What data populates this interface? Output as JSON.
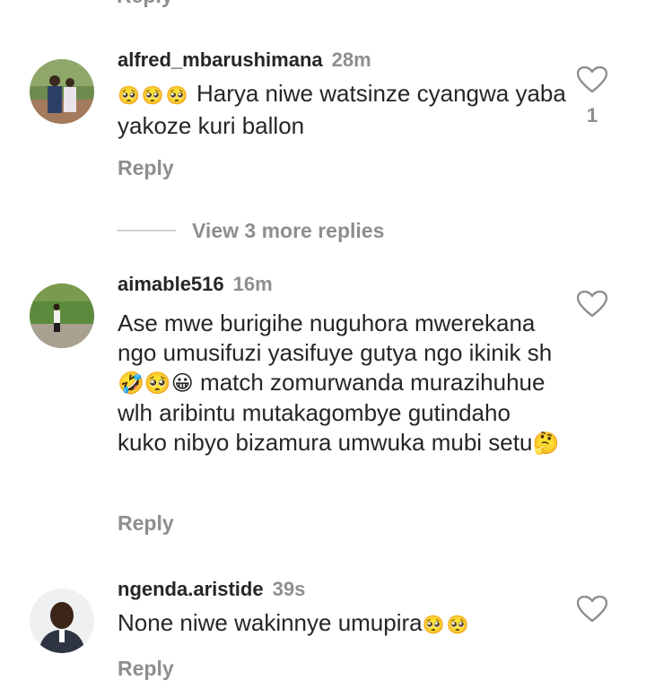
{
  "top_partial_reply": "Reply",
  "comments": [
    {
      "username": "alfred_mbarushimana",
      "time": "28m",
      "text_prefix_emoji": "🥺🥺🥺",
      "text": "Harya niwe watsinze cyangwa yaba yakoze kuri ballon",
      "reply_label": "Reply",
      "like_count": "1",
      "avatar_icon": "avatar-couple-photo"
    },
    {
      "username": "aimable516",
      "time": "16m",
      "text_part1": "Ase mwe burigihe nuguhora mwerekana ngo umusifuzi yasifuye gutya ngo ikinik sh",
      "emoji_mid": "🤣🥺😀",
      "text_part2": "match zomurwanda murazihuhue wlh aribintu mutakagombye gutindaho kuko nibyo bizamura umwuka mubi setu",
      "emoji_end": "🤔",
      "reply_label": "Reply",
      "avatar_icon": "avatar-person-field"
    },
    {
      "username": "ngenda.aristide",
      "time": "39s",
      "text": "None niwe wakinnye umupira",
      "emoji_end": "🥺🥺",
      "reply_label": "Reply",
      "avatar_icon": "avatar-man-portrait"
    }
  ],
  "view_more_label": "View 3 more replies",
  "colors": {
    "primary_text": "#262626",
    "secondary_text": "#8e8e8e",
    "divider": "#d2d2d2",
    "background": "#ffffff"
  }
}
